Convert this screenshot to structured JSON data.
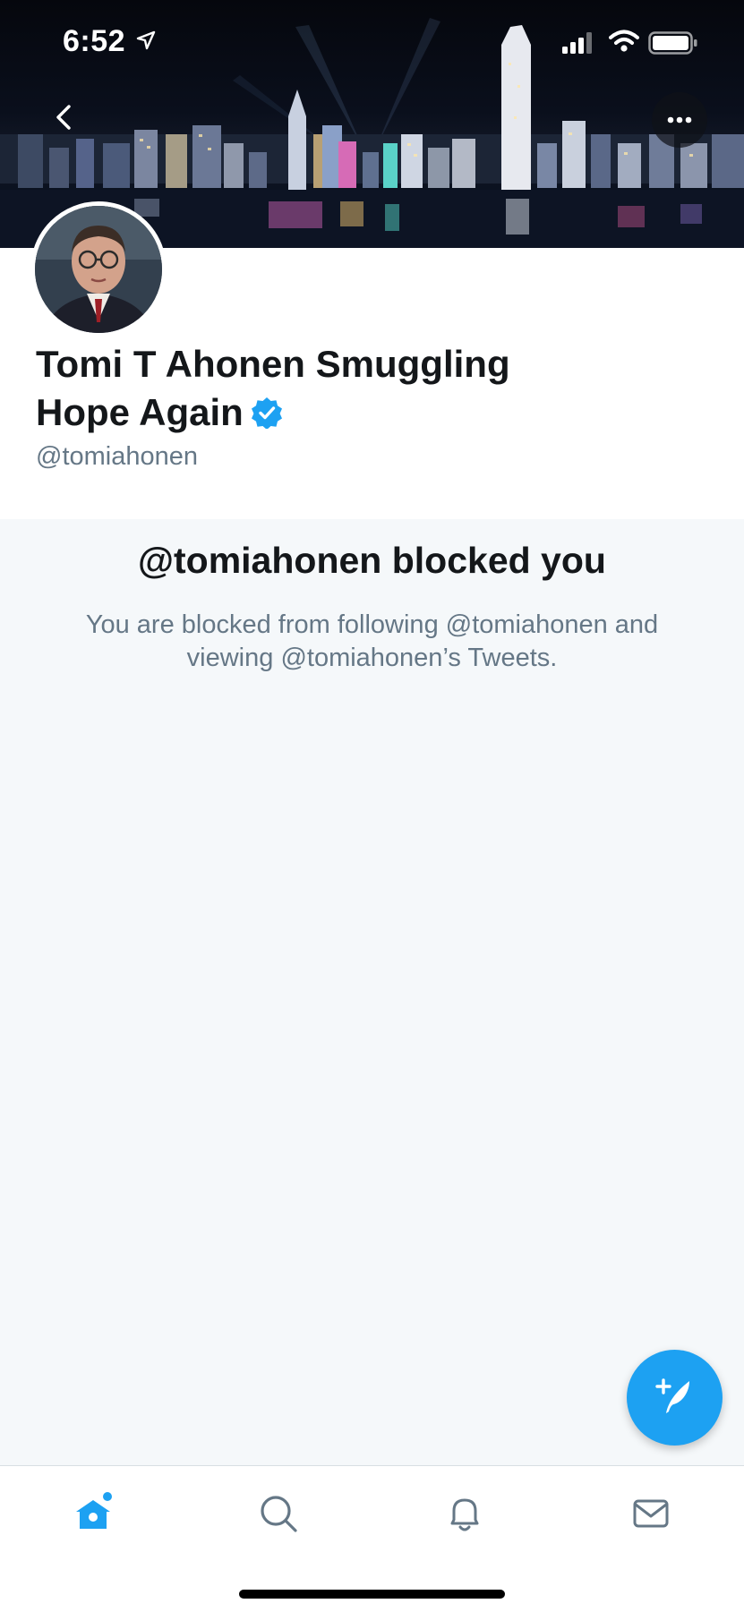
{
  "status_bar": {
    "time": "6:52",
    "location_icon": "location-arrow-icon",
    "signal_icon": "cellular-signal-icon",
    "wifi_icon": "wifi-icon",
    "battery_icon": "battery-icon"
  },
  "header": {
    "back_icon": "chevron-left-icon",
    "more_icon": "more-dots-icon"
  },
  "profile": {
    "display_name": "Tomi T Ahonen Smuggling Hope Again",
    "verified_icon": "verified-badge-icon",
    "handle": "@tomiahonen"
  },
  "blocked": {
    "title": "@tomiahonen blocked you",
    "message": "You are blocked from following @tomiahonen and viewing @tomiahonen’s Tweets."
  },
  "compose": {
    "icon": "compose-tweet-icon"
  },
  "tab_bar": {
    "items": [
      {
        "name": "home",
        "icon": "home-icon",
        "active": true,
        "has_notification_dot": true
      },
      {
        "name": "search",
        "icon": "search-icon",
        "active": false
      },
      {
        "name": "notifications",
        "icon": "bell-icon",
        "active": false
      },
      {
        "name": "messages",
        "icon": "envelope-icon",
        "active": false
      }
    ]
  },
  "colors": {
    "accent": "#1da1f2",
    "text_primary": "#14171a",
    "text_secondary": "#657786",
    "background": "#f5f8fa",
    "card": "#ffffff",
    "tab_icon": "#657786"
  }
}
